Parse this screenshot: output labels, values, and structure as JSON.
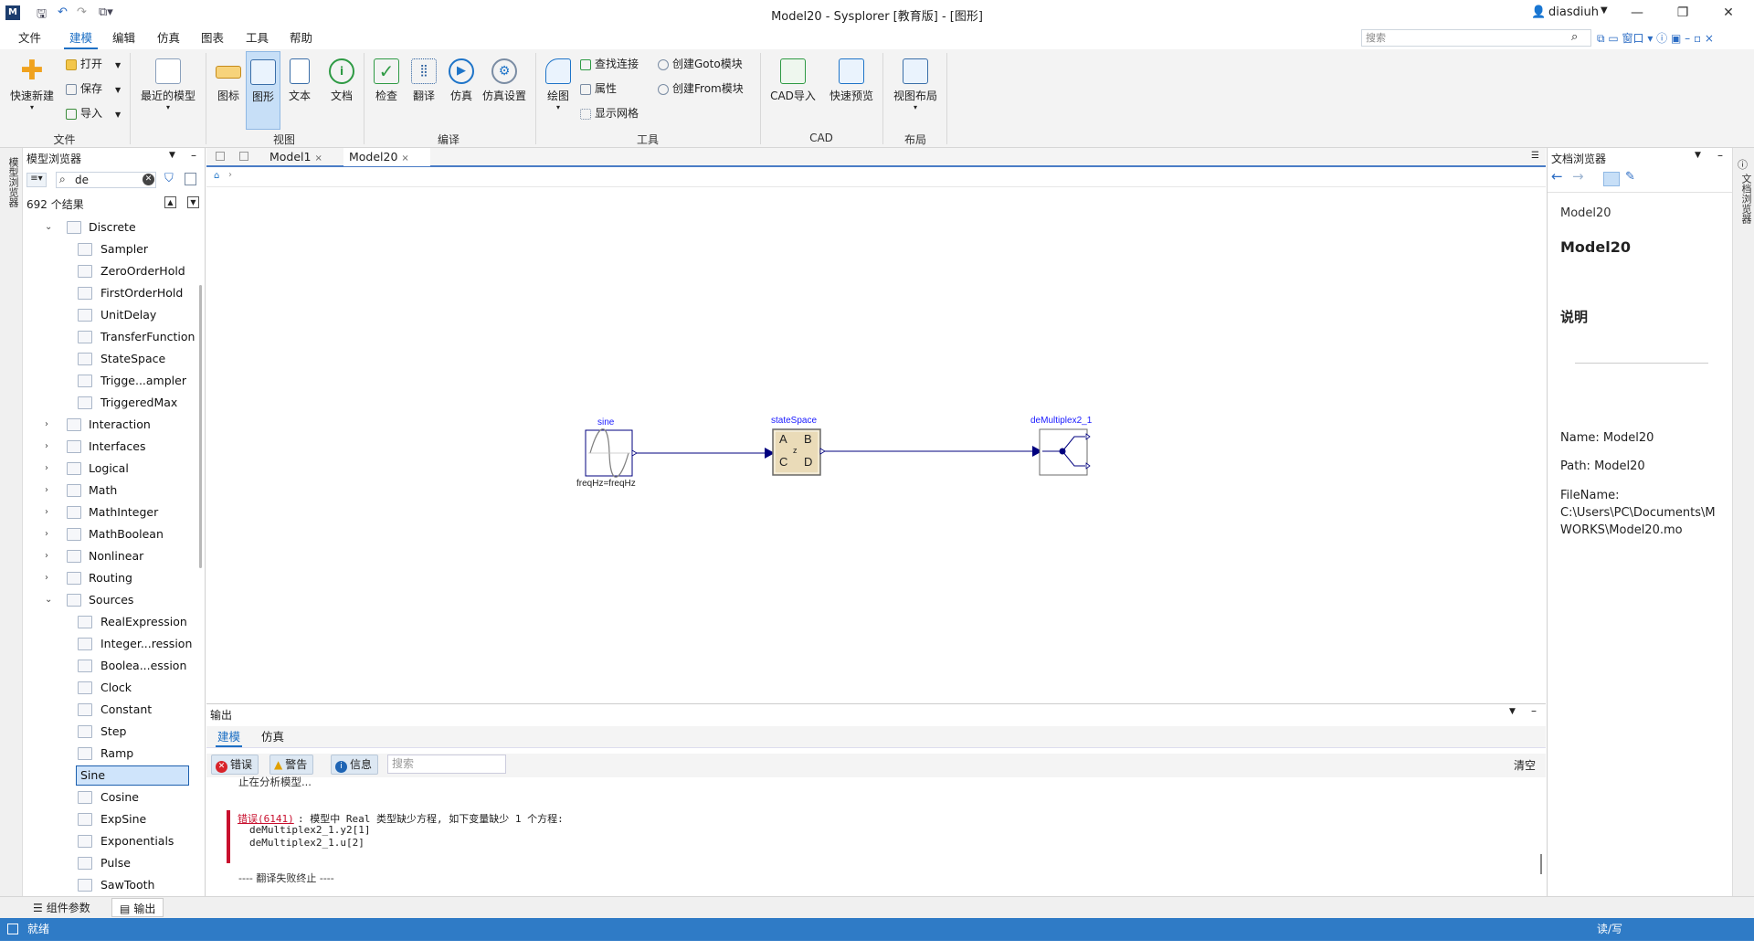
{
  "titlebar": {
    "title": "Model20 - Sysplorer [教育版] - [图形]",
    "user": "diasdiuh",
    "logo": "M"
  },
  "menu": [
    "文件",
    "建模",
    "编辑",
    "仿真",
    "图表",
    "工具",
    "帮助"
  ],
  "search_placeholder": "搜索",
  "ribbon": {
    "file_group": {
      "new": "快速新建",
      "open": "打开",
      "save": "保存",
      "import": "导入",
      "label": "文件"
    },
    "recent": "最近的模型",
    "view_group": {
      "icon": "图标",
      "diagram": "图形",
      "text": "文本",
      "doc": "文档",
      "label": "视图"
    },
    "compile_group": {
      "check": "检查",
      "translate": "翻译",
      "simulate": "仿真",
      "settings": "仿真设置",
      "label": "编译"
    },
    "tools_group": {
      "draw": "绘图",
      "find": "查找连接",
      "props": "属性",
      "grid": "显示网格",
      "goto": "创建Goto模块",
      "from": "创建From模块",
      "label": "工具"
    },
    "cad_group": {
      "import": "CAD导入",
      "preview": "快速预览",
      "label": "CAD"
    },
    "layout_group": {
      "layout": "视图布局",
      "label": "布局"
    }
  },
  "model_browser": {
    "title": "模型浏览器",
    "search_value": "de",
    "result_count": "692 个结果",
    "side_tab": "模型浏览器",
    "items": [
      {
        "label": "Discrete",
        "level": 0,
        "expanded": true,
        "sel": false
      },
      {
        "label": "Sampler",
        "level": 1,
        "sel": false
      },
      {
        "label": "ZeroOrderHold",
        "level": 1,
        "sel": false
      },
      {
        "label": "FirstOrderHold",
        "level": 1,
        "sel": false
      },
      {
        "label": "UnitDelay",
        "level": 1,
        "sel": false
      },
      {
        "label": "TransferFunction",
        "level": 1,
        "sel": false
      },
      {
        "label": "StateSpace",
        "level": 1,
        "sel": false
      },
      {
        "label": "Trigge...ampler",
        "level": 1,
        "sel": false
      },
      {
        "label": "TriggeredMax",
        "level": 1,
        "sel": false
      },
      {
        "label": "Interaction",
        "level": 0,
        "expanded": false,
        "sel": false
      },
      {
        "label": "Interfaces",
        "level": 0,
        "expanded": false,
        "sel": false
      },
      {
        "label": "Logical",
        "level": 0,
        "expanded": false,
        "sel": false
      },
      {
        "label": "Math",
        "level": 0,
        "expanded": false,
        "sel": false
      },
      {
        "label": "MathInteger",
        "level": 0,
        "expanded": false,
        "sel": false
      },
      {
        "label": "MathBoolean",
        "level": 0,
        "expanded": false,
        "sel": false
      },
      {
        "label": "Nonlinear",
        "level": 0,
        "expanded": false,
        "sel": false
      },
      {
        "label": "Routing",
        "level": 0,
        "expanded": false,
        "sel": false
      },
      {
        "label": "Sources",
        "level": 0,
        "expanded": true,
        "sel": false
      },
      {
        "label": "RealExpression",
        "level": 1,
        "sel": false
      },
      {
        "label": "Integer...ression",
        "level": 1,
        "sel": false
      },
      {
        "label": "Boolea...ession",
        "level": 1,
        "sel": false
      },
      {
        "label": "Clock",
        "level": 1,
        "sel": false
      },
      {
        "label": "Constant",
        "level": 1,
        "sel": false
      },
      {
        "label": "Step",
        "level": 1,
        "sel": false
      },
      {
        "label": "Ramp",
        "level": 1,
        "sel": false
      },
      {
        "label": "Sine",
        "level": 1,
        "sel": true
      },
      {
        "label": "Cosine",
        "level": 1,
        "sel": false
      },
      {
        "label": "ExpSine",
        "level": 1,
        "sel": false
      },
      {
        "label": "Exponentials",
        "level": 1,
        "sel": false
      },
      {
        "label": "Pulse",
        "level": 1,
        "sel": false
      },
      {
        "label": "SawTooth",
        "level": 1,
        "sel": false
      }
    ]
  },
  "doc_tabs": [
    {
      "label": "Model1",
      "active": false
    },
    {
      "label": "Model20",
      "active": true
    }
  ],
  "diagram": {
    "sine": {
      "name": "sine",
      "param": "freqHz=freqHz"
    },
    "statespace": {
      "name": "stateSpace",
      "a": "A",
      "b": "B",
      "c": "C",
      "d": "D",
      "z": "z"
    },
    "demux": {
      "name": "deMultiplex2_1"
    }
  },
  "output": {
    "title": "输出",
    "tabs": [
      "建模",
      "仿真"
    ],
    "filters": {
      "error": "错误",
      "warning": "警告",
      "info": "信息"
    },
    "search_placeholder": "搜索",
    "clear": "清空",
    "lines": {
      "analyzing": "止在分析模型...",
      "error_code": "错误(6141)",
      "error_msg": ": 模型中 Real 类型缺少方程, 如下变量缺少 1 个方程:",
      "var1": "deMultiplex2_1.y2[1]",
      "var2": "deMultiplex2_1.u[2]",
      "fail": "---- 翻译失败终止 ----"
    }
  },
  "doc_browser": {
    "title": "文档浏览器",
    "crumb": "Model20",
    "model": "Model20",
    "section": "说明",
    "name_line": "Name: Model20",
    "path_line": "Path: Model20",
    "file_label": "FileName:",
    "file_path1": "C:\\Users\\PC\\Documents\\M",
    "file_path2": "WORKS\\Model20.mo",
    "side_tab": "文档浏览器"
  },
  "bottom_tabs": {
    "params": "组件参数",
    "output": "输出"
  },
  "status": {
    "left": "就绪",
    "right": "读/写"
  }
}
